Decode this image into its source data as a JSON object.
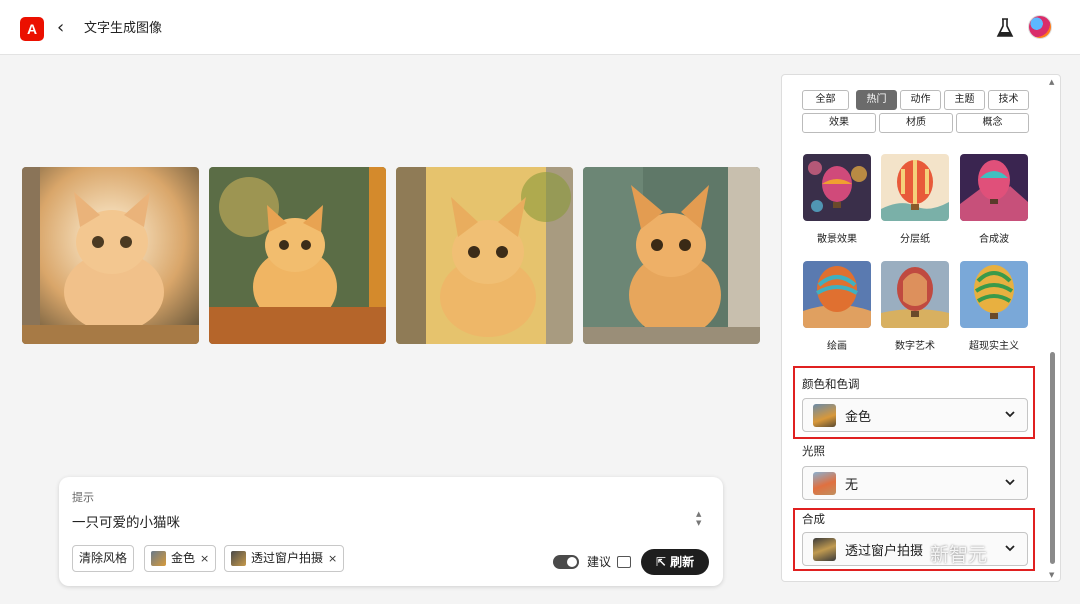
{
  "header": {
    "app_title": "文字生成图像",
    "back_icon": "chevron-left-icon",
    "logo": "adobe-logo",
    "lab_icon": "flask-icon"
  },
  "images": [
    "kitten-1",
    "kitten-2",
    "kitten-3",
    "kitten-4"
  ],
  "prompt": {
    "label": "提示",
    "text": "一只可爱的小猫咪",
    "clear_style": "清除风格",
    "chips": [
      {
        "label": "金色"
      },
      {
        "label": "透过窗户拍摄"
      }
    ],
    "chip_close": "×",
    "suggest_label": "建议",
    "refresh_label": "刷新"
  },
  "panel": {
    "filters": [
      "全部",
      "热门",
      "动作",
      "主题",
      "技术",
      "效果",
      "材质",
      "概念"
    ],
    "active_filter": "热门",
    "styles": [
      "散景效果",
      "分层纸",
      "合成波",
      "绘画",
      "数字艺术",
      "超现实主义"
    ],
    "color_tone": {
      "title": "颜色和色调",
      "value": "金色"
    },
    "lighting": {
      "title": "光照",
      "value": "无"
    },
    "composition": {
      "title": "合成",
      "value": "透过窗户拍摄"
    }
  },
  "watermark": "新智元",
  "colors": {
    "accent_red": "#e02020",
    "brand": "#eb1000",
    "button_dark": "#1e1e1e"
  }
}
